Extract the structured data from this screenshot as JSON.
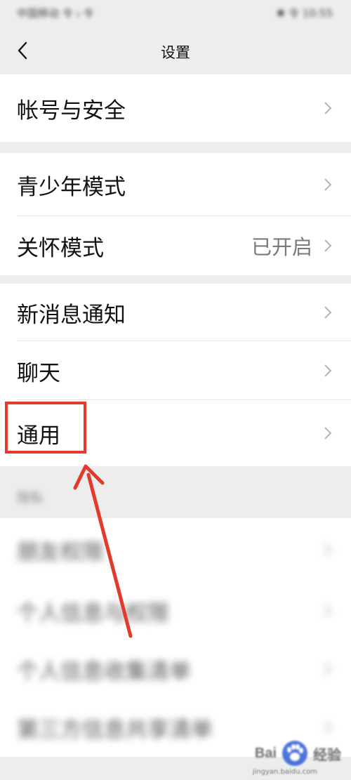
{
  "status_bar": {
    "left": "中国移动 令 ᵢₗ 令",
    "right": "✱ 令 10:55"
  },
  "nav": {
    "title": "设置"
  },
  "groups": [
    {
      "items": [
        {
          "label": "帐号与安全"
        }
      ]
    },
    {
      "items": [
        {
          "label": "青少年模式"
        },
        {
          "label": "关怀模式",
          "value": "已开启"
        }
      ]
    },
    {
      "items": [
        {
          "label": "新消息通知"
        },
        {
          "label": "聊天"
        },
        {
          "label": "通用"
        }
      ]
    }
  ],
  "privacy": {
    "header": "隐私",
    "items": [
      {
        "label": "朋友权限"
      },
      {
        "label": "个人信息与权限"
      },
      {
        "label": "个人信息收集清单"
      },
      {
        "label": "第三方信息共享清单"
      }
    ]
  },
  "watermark": {
    "brand": "Bai",
    "suffix": "经验",
    "url": "jingyan.baidu.com"
  },
  "colors": {
    "highlight": "#e33a2c",
    "background": "#ededed"
  }
}
